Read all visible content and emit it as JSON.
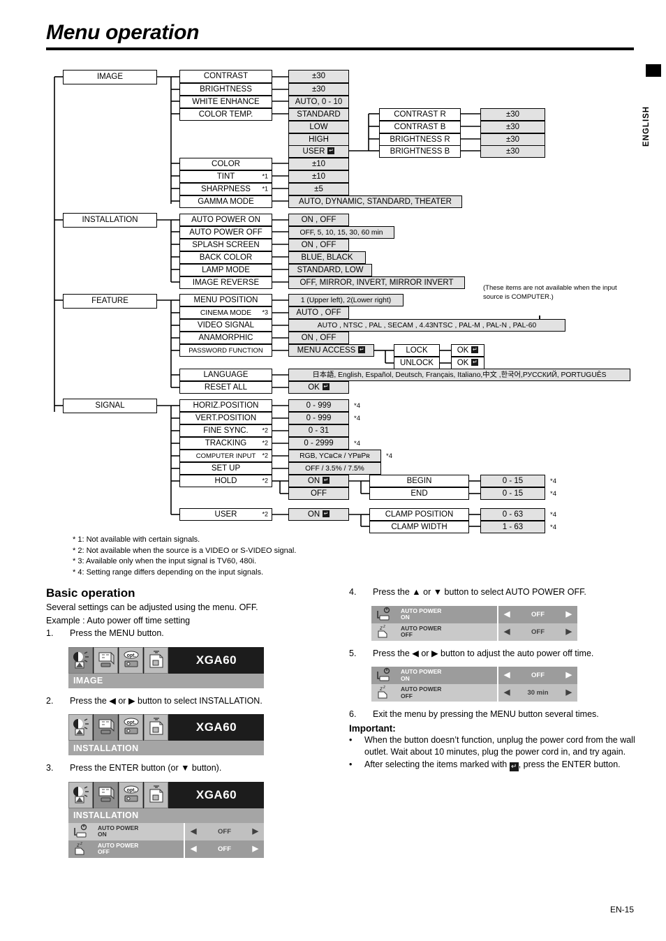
{
  "page": {
    "title": "Menu operation",
    "language_tab": "ENGLISH",
    "page_number": "EN-15"
  },
  "tree": {
    "note": "(These items are not available when the input source is COMPUTER.)",
    "menus": {
      "image": "IMAGE",
      "installation": "INSTALLATION",
      "feature": "FEATURE",
      "signal": "SIGNAL"
    },
    "image_items": {
      "contrast": "CONTRAST",
      "contrast_val": "±30",
      "brightness": "BRIGHTNESS",
      "brightness_val": "±30",
      "white_enhance": "WHITE ENHANCE",
      "white_enhance_val": "AUTO, 0 - 10",
      "color_temp": "COLOR TEMP.",
      "color_temp_standard": "STANDARD",
      "color_temp_low": "LOW",
      "color_temp_high": "HIGH",
      "color_temp_user": "USER",
      "user_contrast_r": "CONTRAST R",
      "user_contrast_r_val": "±30",
      "user_contrast_b": "CONTRAST B",
      "user_contrast_b_val": "±30",
      "user_brightness_r": "BRIGHTNESS R",
      "user_brightness_r_val": "±30",
      "user_brightness_b": "BRIGHTNESS B",
      "user_brightness_b_val": "±30",
      "color": "COLOR",
      "color_val": "±10",
      "tint": "TINT",
      "tint_note": "*1",
      "tint_val": "±10",
      "sharpness": "SHARPNESS",
      "sharpness_note": "*1",
      "sharpness_val": "±5",
      "gamma_mode": "GAMMA MODE",
      "gamma_mode_val": "AUTO, DYNAMIC, STANDARD, THEATER"
    },
    "installation_items": {
      "auto_power_on": "AUTO POWER ON",
      "auto_power_on_val": "ON , OFF",
      "auto_power_off": "AUTO POWER OFF",
      "auto_power_off_val": "OFF,  5,  10,  15,  30,  60 min",
      "splash_screen": "SPLASH SCREEN",
      "splash_screen_val": "ON , OFF",
      "back_color": "BACK COLOR",
      "back_color_val": "BLUE, BLACK",
      "lamp_mode": "LAMP MODE",
      "lamp_mode_val": "STANDARD, LOW",
      "image_reverse": "IMAGE REVERSE",
      "image_reverse_val": "OFF, MIRROR, INVERT, MIRROR INVERT"
    },
    "feature_items": {
      "menu_position": "MENU POSITION",
      "menu_position_val": "1 (Upper left), 2(Lower right)",
      "cinema_mode": "CINEMA MODE",
      "cinema_mode_note": "*3",
      "cinema_mode_val": "AUTO , OFF",
      "video_signal": "VIDEO SIGNAL",
      "video_signal_val": "AUTO , NTSC , PAL , SECAM , 4.43NTSC , PAL-M , PAL-N , PAL-60",
      "anamorphic": "ANAMORPHIC",
      "anamorphic_val": "ON , OFF",
      "password_function": "PASSWORD FUNCTION",
      "menu_access": "MENU ACCESS",
      "lock": "LOCK",
      "lock_ok": "OK",
      "unlock": "UNLOCK",
      "unlock_ok": "OK",
      "language": "LANGUAGE",
      "language_val": "日本語, English, Español, Deutsch, Français, Italiano,中文 ,한국어,РУССКИЙ, PORTUGUÊS",
      "reset_all": "RESET ALL",
      "reset_all_ok": "OK"
    },
    "signal_items": {
      "horiz_position": "HORIZ.POSITION",
      "horiz_position_val": "0 - 999",
      "horiz_position_note": "*4",
      "vert_position": "VERT.POSITION",
      "vert_position_val": "0 - 999",
      "vert_position_note": "*4",
      "fine_sync": "FINE SYNC.",
      "fine_sync_note": "*2",
      "fine_sync_val": "0 - 31",
      "tracking": "TRACKING",
      "tracking_note": "*2",
      "tracking_val": "0 - 2999",
      "tracking_note4": "*4",
      "computer_input": "COMPUTER INPUT",
      "computer_input_note": "*2",
      "computer_input_val": "RGB, YCʙCʀ / YPʙPʀ",
      "computer_input_note4": "*4",
      "set_up": "SET UP",
      "set_up_val": "OFF / 3.5% / 7.5%",
      "hold": "HOLD",
      "hold_note": "*2",
      "hold_on": "ON",
      "hold_off": "OFF",
      "begin": "BEGIN",
      "begin_val": "0 - 15",
      "begin_note": "*4",
      "end": "END",
      "end_val": "0 - 15",
      "end_note": "*4",
      "user": "USER",
      "user_note": "*2",
      "user_on": "ON",
      "clamp_position": "CLAMP POSITION",
      "clamp_position_val": "0 - 63",
      "clamp_position_note": "*4",
      "clamp_width": "CLAMP WIDTH",
      "clamp_width_val": "1 - 63",
      "clamp_width_note": "*4"
    }
  },
  "footnotes": [
    "* 1: Not available with certain signals.",
    "* 2: Not available when the source is a VIDEO or S-VIDEO signal.",
    "* 3: Available only when the input signal is TV60, 480i.",
    "* 4: Setting range differs depending on the input signals."
  ],
  "basic_operation": {
    "heading": "Basic operation",
    "intro1": "Several settings can be adjusted using the menu. OFF.",
    "intro2": "Example : Auto power off time setting",
    "step1_num": "1.",
    "step1_text": "Press the MENU button.",
    "step2_num": "2.",
    "step2_text": "Press the ◀ or ▶ button to select INSTALLATION.",
    "step3_num": "3.",
    "step3_text": "Press the ENTER button (or ▼ button).",
    "step4_num": "4.",
    "step4_text": "Press the ▲ or ▼ button to select AUTO POWER OFF.",
    "step5_num": "5.",
    "step5_text": "Press the ◀ or ▶ button to adjust the auto power off time.",
    "step6_num": "6.",
    "step6_text": "Exit the menu by pressing the MENU button several times.",
    "important_heading": "Important:",
    "bullet1": "When the button doesn’t function, unplug the power cord from the wall outlet. Wait about 10 minutes, plug the power cord in, and try again.",
    "bullet2_a": "After selecting the items marked with",
    "bullet2_b": ", press the ENTER button."
  },
  "osd": {
    "signal_label": "XGA60",
    "tab_image": "image-tab-icon",
    "tab_installation": "installation-tab-icon",
    "tab_feature": "feature-tab-icon",
    "tab_signal": "signal-tab-icon",
    "sub_image": "IMAGE",
    "sub_installation": "INSTALLATION",
    "row_auto_power_on_l1": "AUTO POWER",
    "row_auto_power_on_l2": "ON",
    "row_auto_power_off_l1": "AUTO POWER",
    "row_auto_power_off_l2": "OFF",
    "value_off": "OFF",
    "value_30min": "30 min",
    "arrow_left": "◀",
    "arrow_right": "▶"
  }
}
